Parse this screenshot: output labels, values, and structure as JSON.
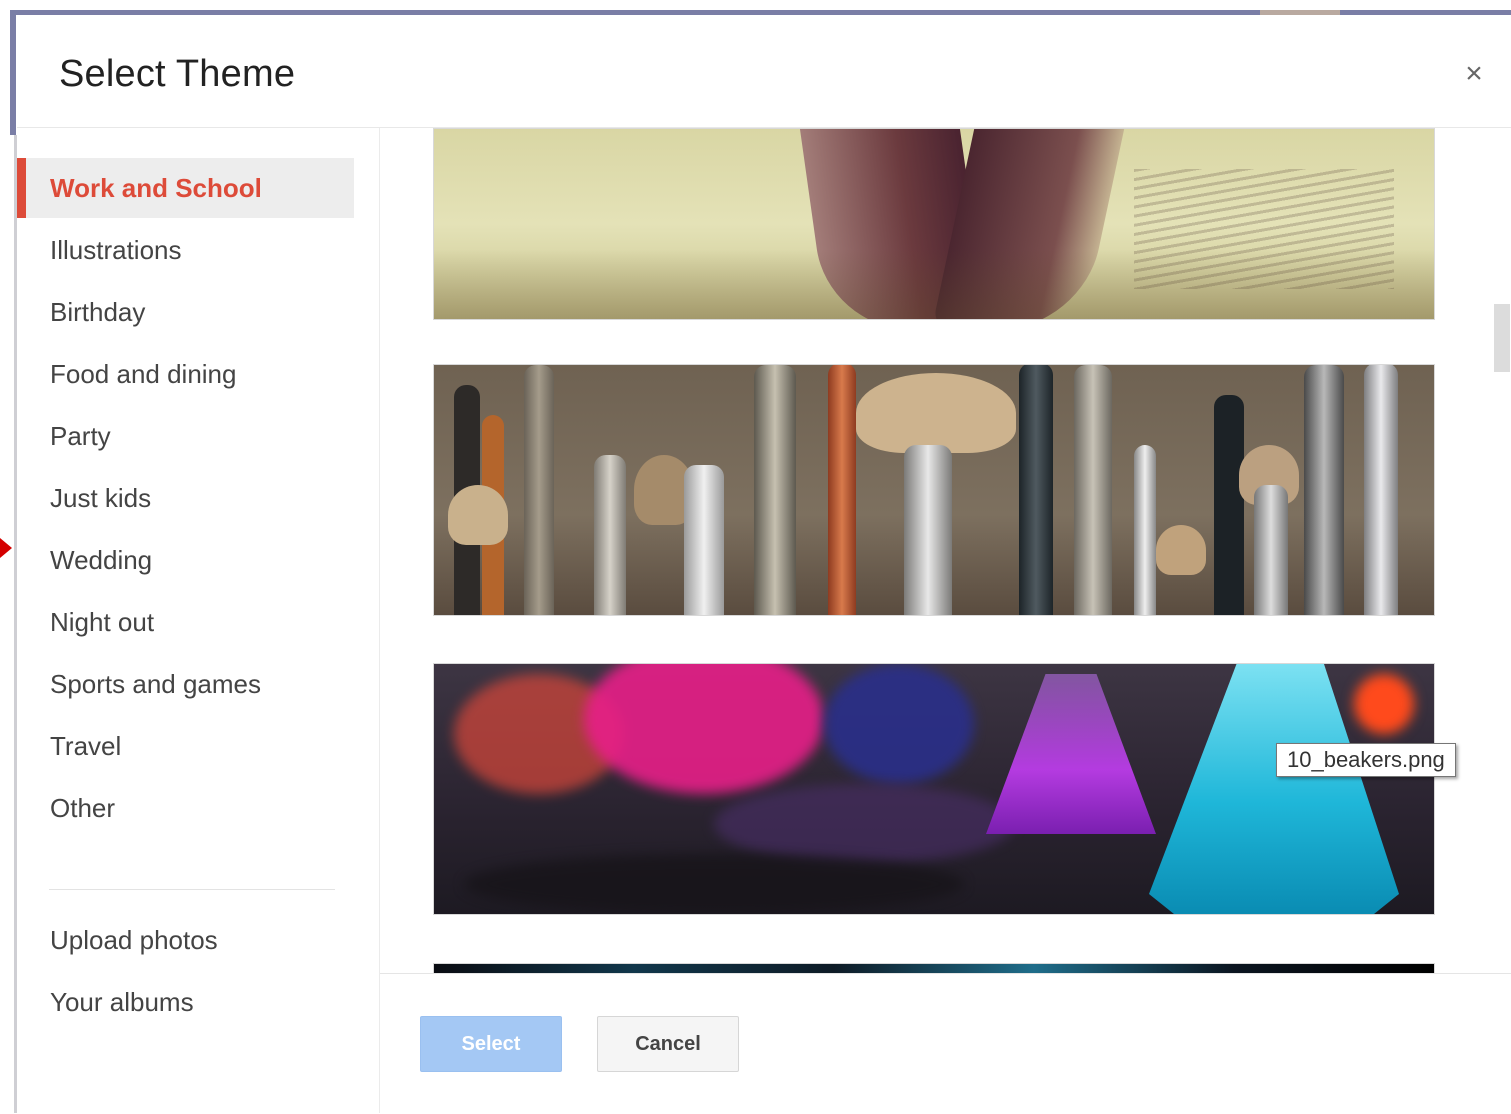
{
  "dialog": {
    "title": "Select Theme",
    "close_icon": "close-icon",
    "close_glyph": "×"
  },
  "sidebar": {
    "categories": [
      {
        "label": "Work and School",
        "active": true
      },
      {
        "label": "Illustrations"
      },
      {
        "label": "Birthday"
      },
      {
        "label": "Food and dining"
      },
      {
        "label": "Party"
      },
      {
        "label": "Just kids"
      },
      {
        "label": "Wedding"
      },
      {
        "label": "Night out"
      },
      {
        "label": "Sports and games"
      },
      {
        "label": "Travel"
      },
      {
        "label": "Other"
      }
    ],
    "sources": [
      {
        "label": "Upload photos"
      },
      {
        "label": "Your albums"
      }
    ]
  },
  "themes": [
    {
      "name": "open-book",
      "icon": "open-book-image"
    },
    {
      "name": "paint-brushes",
      "icon": "paint-brushes-image"
    },
    {
      "name": "beakers",
      "icon": "beakers-image",
      "tooltip": "10_beakers.png"
    },
    {
      "name": "partial",
      "icon": "partial-image"
    }
  ],
  "footer": {
    "select_label": "Select",
    "cancel_label": "Cancel"
  },
  "colors": {
    "accent": "#dd4b39",
    "select_button": "#a4c8f4",
    "active_bg": "#ededed"
  }
}
